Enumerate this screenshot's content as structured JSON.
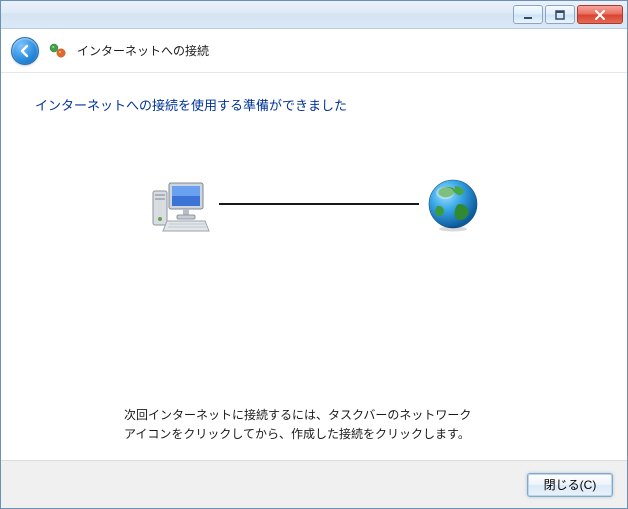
{
  "window": {
    "minimize_label": "Minimize",
    "maximize_label": "Maximize",
    "close_label": "Close"
  },
  "header": {
    "back_label": "Back",
    "title": "インターネットへの接続"
  },
  "main": {
    "heading": "インターネットへの接続を使用する準備ができました",
    "instruction_line1": "次回インターネットに接続するには、タスクバーのネットワーク",
    "instruction_line2": "アイコンをクリックしてから、作成した接続をクリックします。"
  },
  "footer": {
    "close_button": "閉じる(C)"
  },
  "icons": {
    "computer": "computer-icon",
    "globe": "globe-icon",
    "wizard": "network-wizard-icon",
    "back_arrow": "back-arrow-icon"
  }
}
